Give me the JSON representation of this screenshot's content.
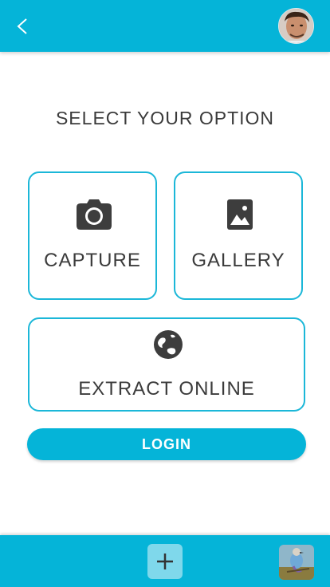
{
  "header": {
    "back_icon": "chevron-left-icon",
    "avatar_icon": "user-avatar"
  },
  "main": {
    "title": "SELECT YOUR OPTION",
    "options": [
      {
        "label": "CAPTURE",
        "icon": "camera-icon"
      },
      {
        "label": "GALLERY",
        "icon": "image-icon"
      },
      {
        "label": "EXTRACT ONLINE",
        "icon": "globe-icon"
      }
    ],
    "login_label": "LOGIN"
  },
  "footer": {
    "add_icon": "plus-icon",
    "thumbnail": "bird-photo-thumbnail"
  },
  "colors": {
    "primary": "#05b4d8",
    "card_border": "#1bb7d8",
    "text": "#3b3b3b",
    "add_button": "#7fd8eb"
  }
}
